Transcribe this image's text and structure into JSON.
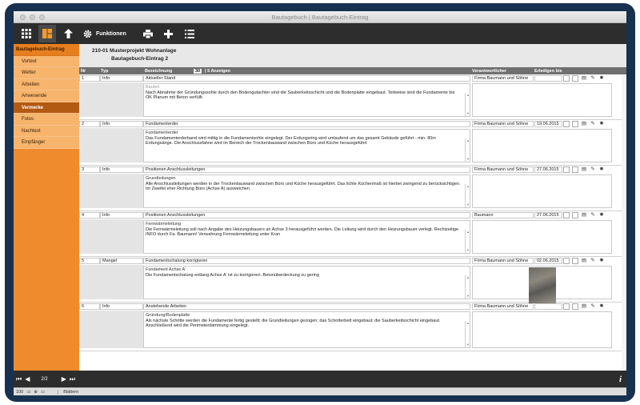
{
  "window": {
    "title": "Bautagebuch | Bautagebuch-Eintrag"
  },
  "toolbar": {
    "funktionen_label": "Funktionen"
  },
  "sidebar": {
    "header": "Bautagebuch-Eintrag",
    "items": [
      {
        "label": "Vortext"
      },
      {
        "label": "Wetter"
      },
      {
        "label": "Arbeiten"
      },
      {
        "label": "Anwesende"
      },
      {
        "label": "Vermerke",
        "active": true
      },
      {
        "label": "Fotos"
      },
      {
        "label": "Nachtext"
      },
      {
        "label": "Empfänger"
      }
    ]
  },
  "project": {
    "line1": "210-01  Musterprojekt Wohnanlage",
    "line2": "Bautagebuch-Eintrag 2"
  },
  "columns": {
    "nr": "Nr",
    "typ": "Typ",
    "bezeichnung": "Bezeichnung",
    "count": "30",
    "anzeigen_label": "|  5  Anzeigen",
    "verantwortlicher": "Verantwortlicher",
    "erledigen_bis": "Erledigen bis"
  },
  "entries": [
    {
      "nr": "1",
      "typ": "Info",
      "bezeichnung": "Aktueller Stand",
      "sub": "Bauteil",
      "sub_muted": true,
      "text": "Nach Abnahme der Gründungssohle durch den Bodengutachter sind die Sauberkeitsschicht und die Bodenplatte eingebaut. Teilweise sind die Fundamente bis OK Planum mit Beton verfüllt.",
      "verantwortlicher": "Firma Baumann und Söhne",
      "datum": ""
    },
    {
      "nr": "2",
      "typ": "Info",
      "bezeichnung": "Fundamenterder",
      "sub": "Fundamenterder",
      "sub_muted": false,
      "text": "Das Fundamenterderband wird mittig in die Fundamentsohle eingelegt. Der Erdungsring wird umlaufend um das gesamt Gebäude geführt - min. 80m Erdungsänge. Die Anschlussfahne wird im Bereich der Trockenbauwand zwischen Büro und Küche herausgeführt",
      "verantwortlicher": "Firma Baumann und Söhne",
      "datum": "19.06.2015"
    },
    {
      "nr": "3",
      "typ": "Info",
      "bezeichnung": "Positionen Anschlussleitungen",
      "sub": "Grundleitungen",
      "sub_muted": false,
      "text": "Alle Anschlussleitungen werden in der Trockenbauwand zwischen Büro und Küche herausgeführt. Das lichte Küchenmaß ist hierbei zwingend zu berücksichtigen. Im Zweifel eher Richtung Büro (Achse A) ausweichen.",
      "verantwortlicher": "Firma Baumann und Söhne",
      "datum": "27.06.2015"
    },
    {
      "nr": "4",
      "typ": "Info",
      "bezeichnung": "Positionen Anschlussleitungen",
      "sub": "Fernwärmeleitung",
      "sub_muted": false,
      "text": "Die Fernwärmeleitung soll nach Angabe des Heizungsbauers an Achse 3 herausgeführt werden. Die Leitung wird durch den Heizungsbauer verlegt. Rechtzeitige INFO durch Fa. Baumann! Verwahrung Fernwärmeleitung unter Kran",
      "verantwortlicher": "Baumann",
      "datum": "27.06.2015"
    },
    {
      "nr": "5",
      "typ": "Mangel",
      "bezeichnung": "Fundamentschalung korrigieren",
      "sub": "Fundament Achse A'",
      "sub_muted": false,
      "text": "Die Fundamentschalung entlang Achse A' ist zu korrigieren. Betonüberdeckung zu gering",
      "verantwortlicher": "Firma Baumann und Söhne",
      "datum": "02.06.2015",
      "photo": true
    },
    {
      "nr": "6",
      "typ": "Info",
      "bezeichnung": "Anstehende Arbeiten",
      "sub": "Gründung/Bodenplatte",
      "sub_muted": false,
      "text": "Als nächste Schritte werden die Fundamente fertig gestellt; die Grundleitungen gezogen; das Schotterbett eingebaut; die Sauberkeitsschicht eingebaut. Anschließend wird die Perimeterdämmung eingelegt.",
      "verantwortlicher": "Firma Baumann und Söhne",
      "datum": ""
    }
  ],
  "footer": {
    "page": "2/2",
    "info_icon": "i"
  },
  "status": {
    "zoom": "100",
    "mode": "Blättern"
  }
}
